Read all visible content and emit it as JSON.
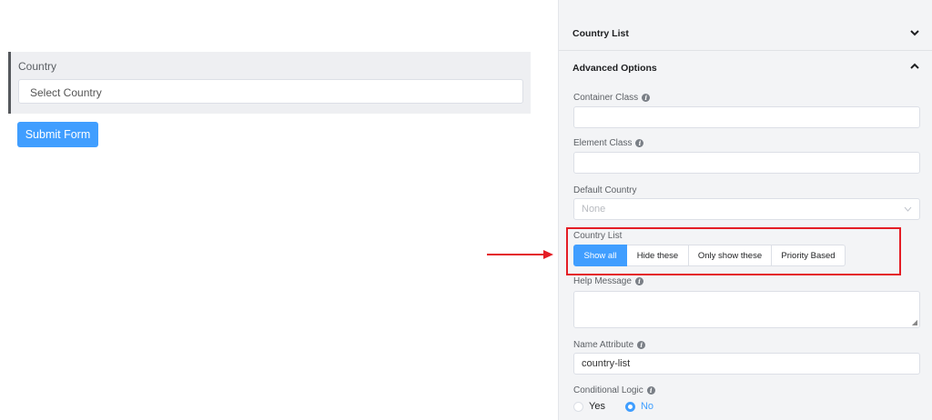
{
  "preview": {
    "country_label": "Country",
    "country_placeholder": "Select Country",
    "submit_label": "Submit Form"
  },
  "panel": {
    "sections": [
      {
        "title": "Country List",
        "chevron": "chevron-down-icon"
      },
      {
        "title": "Advanced Options",
        "chevron": "chevron-up-icon"
      }
    ],
    "fields": {
      "container_class": {
        "label": "Container Class",
        "value": ""
      },
      "element_class": {
        "label": "Element Class",
        "value": ""
      },
      "default_country": {
        "label": "Default Country",
        "placeholder": "None"
      },
      "country_list": {
        "label": "Country List",
        "options": [
          "Show all",
          "Hide these",
          "Only show these",
          "Priority Based"
        ],
        "selected": "Show all"
      },
      "help_message": {
        "label": "Help Message",
        "value": ""
      },
      "name_attribute": {
        "label": "Name Attribute",
        "value": "country-list"
      },
      "conditional_logic": {
        "label": "Conditional Logic",
        "options": [
          "Yes",
          "No"
        ],
        "selected": "No"
      }
    }
  },
  "colors": {
    "accent": "#409eff",
    "highlight": "#e41d25"
  }
}
